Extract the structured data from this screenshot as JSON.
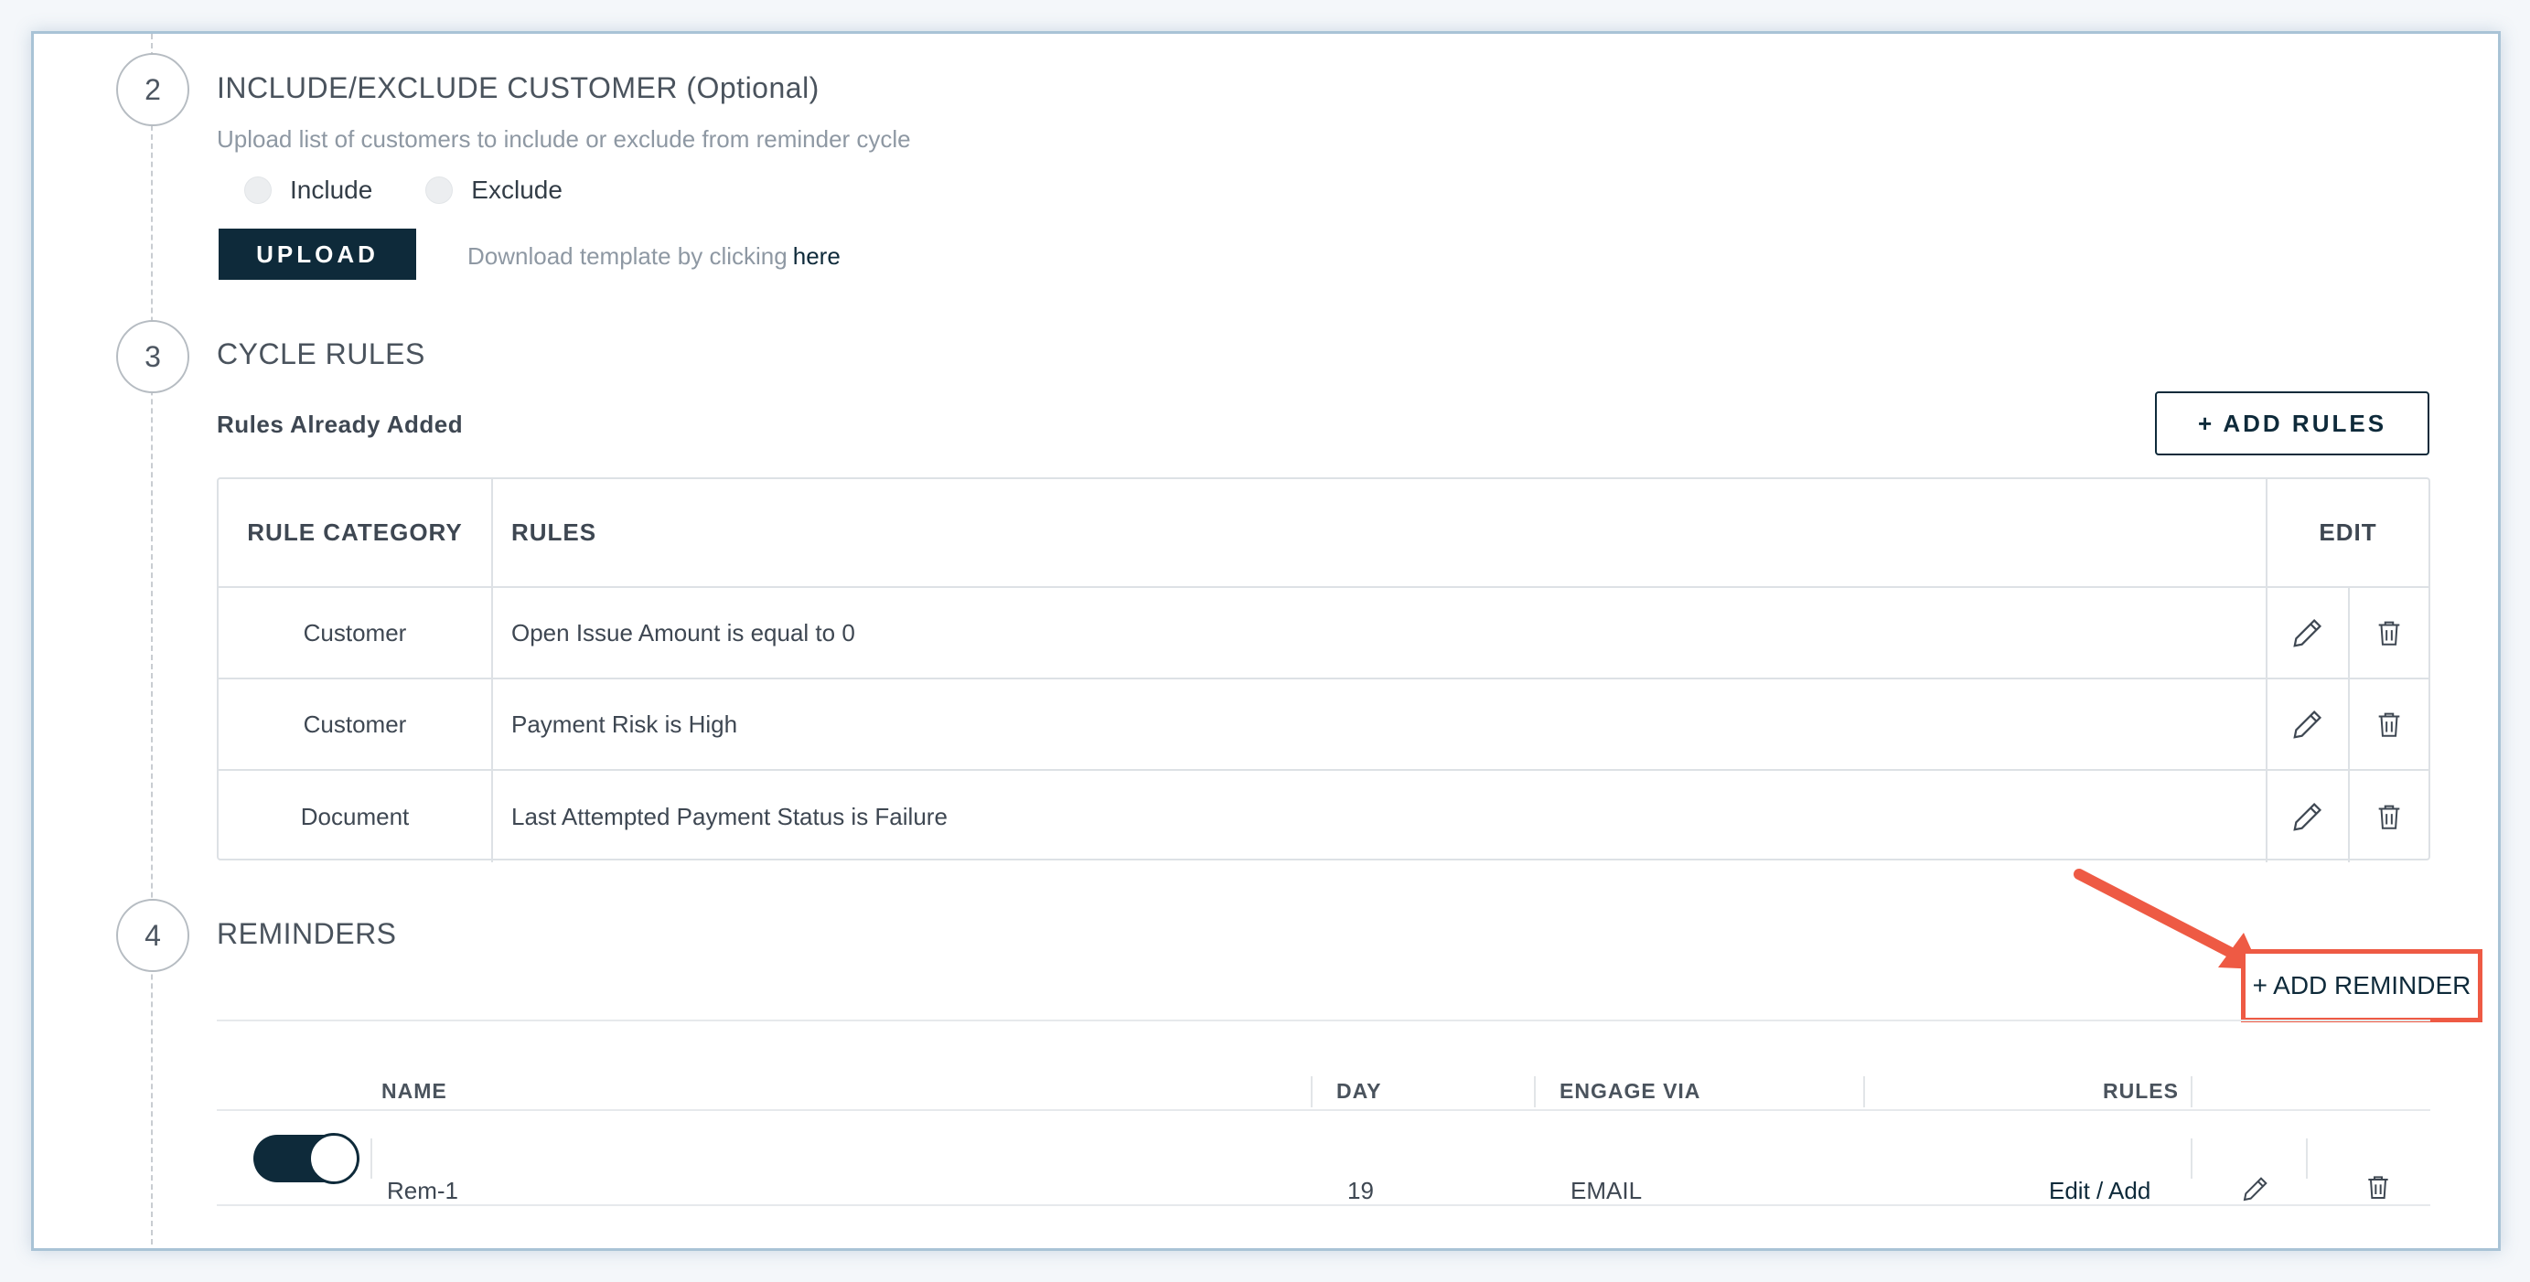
{
  "steps": {
    "include_exclude": {
      "number": "2",
      "title": "INCLUDE/EXCLUDE CUSTOMER (Optional)",
      "subtitle": "Upload list of customers to include or exclude from reminder cycle",
      "radio_include": "Include",
      "radio_exclude": "Exclude",
      "upload_label": "UPLOAD",
      "template_text": "Download template by clicking",
      "template_link": "here"
    },
    "cycle_rules": {
      "number": "3",
      "title": "CYCLE RULES",
      "rules_added_label": "Rules Already Added",
      "add_rules_label": "+ ADD RULES",
      "table": {
        "headers": {
          "category": "RULE CATEGORY",
          "rules": "RULES",
          "edit": "EDIT"
        },
        "rows": [
          {
            "category": "Customer",
            "rule": "Open Issue Amount is equal to 0"
          },
          {
            "category": "Customer",
            "rule": "Payment Risk is High"
          },
          {
            "category": "Document",
            "rule": "Last Attempted Payment Status is Failure"
          }
        ]
      }
    },
    "reminders": {
      "number": "4",
      "title": "REMINDERS",
      "add_reminder_label": "+ ADD REMINDER",
      "headers": {
        "name": "NAME",
        "day": "DAY",
        "engage_via": "ENGAGE VIA",
        "rules": "RULES"
      },
      "rows": [
        {
          "enabled": true,
          "name": "Rem-1",
          "day": "19",
          "engage_via": "EMAIL",
          "rules_link": "Edit / Add"
        }
      ]
    }
  },
  "colors": {
    "primary": "#0e2a3a",
    "highlight": "#ee5a44",
    "muted_text": "#8e98a3",
    "border": "#dde1e5"
  }
}
